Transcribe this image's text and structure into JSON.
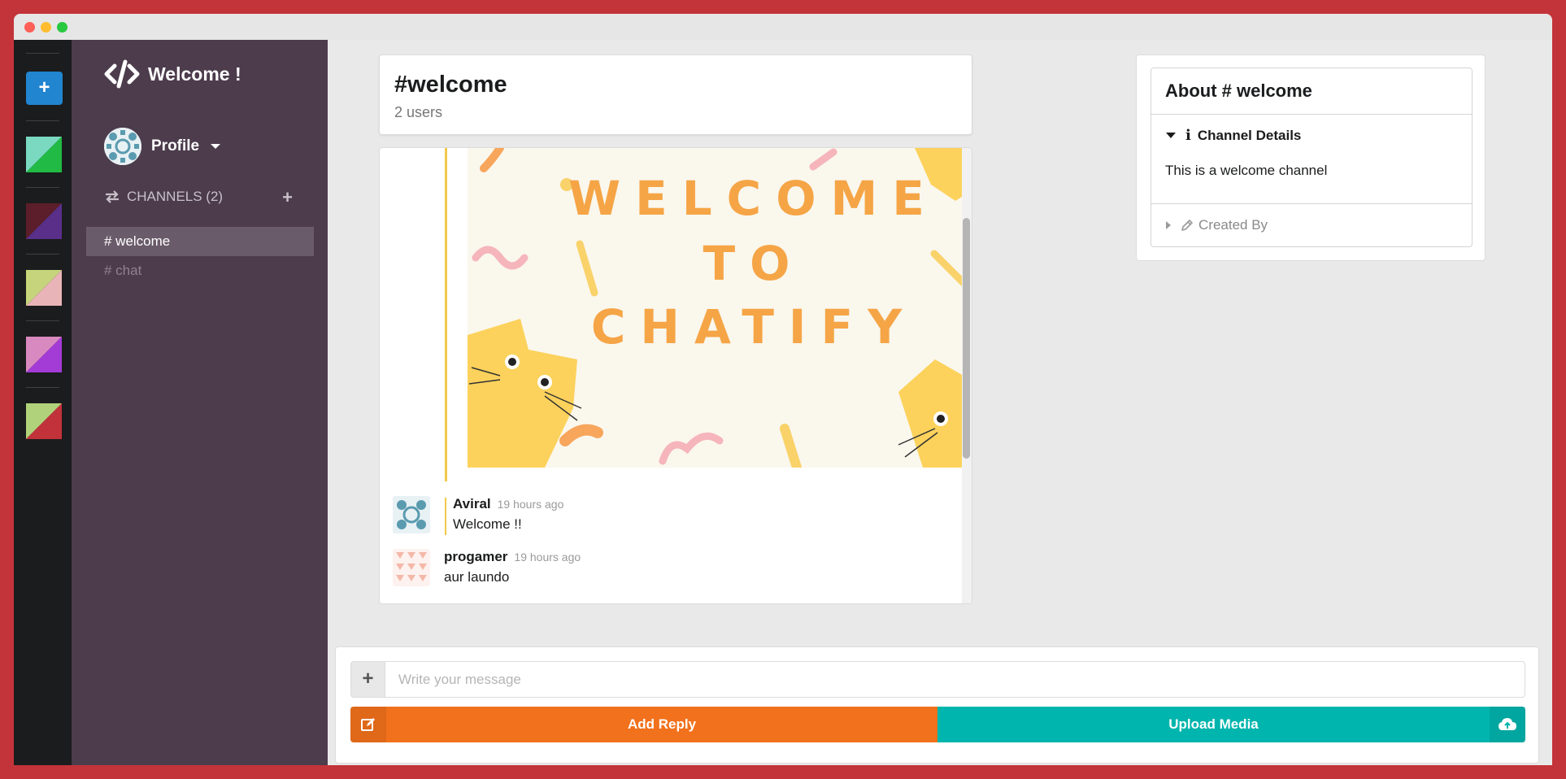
{
  "colors": {
    "frame": "#c3343a",
    "sidebar": "#4c3c4c",
    "colorbar": "#1b1c1d",
    "add_button": "#2185d0",
    "reply": "#f2711c",
    "upload": "#00b5ad",
    "message_accent": "#f2c84b"
  },
  "colorpanel": {
    "add_icon": "plus-icon",
    "swatches": [
      {
        "primary": "#21ba45",
        "secondary": "#7ad9c0"
      },
      {
        "primary": "#5a2f8a",
        "secondary": "#5b1e2a"
      },
      {
        "primary": "#e8b4b8",
        "secondary": "#c6d47c"
      },
      {
        "primary": "#a33bd6",
        "secondary": "#d88ac0"
      },
      {
        "primary": "#c2323a",
        "secondary": "#b0d27a"
      }
    ]
  },
  "sidebar": {
    "brand_icon": "code-icon",
    "title": "Welcome !",
    "profile_label": "Profile",
    "channels_header": "CHANNELS (2)",
    "channels": [
      {
        "label": "# welcome",
        "active": true
      },
      {
        "label": "# chat",
        "active": false
      }
    ]
  },
  "channel": {
    "title": "#welcome",
    "users": "2 users"
  },
  "messages": {
    "image_text": [
      "WELCOME",
      "TO",
      "CHATIFY"
    ],
    "items": [
      {
        "author": "Aviral",
        "time": "19 hours ago",
        "text": "Welcome !!"
      },
      {
        "author": "progamer",
        "time": "19 hours ago",
        "text": "aur laundo"
      }
    ]
  },
  "meta_panel": {
    "title": "About # welcome",
    "details_title": "Channel Details",
    "details_content": "This is a welcome channel",
    "created_by_title": "Created By"
  },
  "form": {
    "placeholder": "Write your message",
    "reply_label": "Add Reply",
    "upload_label": "Upload Media"
  }
}
